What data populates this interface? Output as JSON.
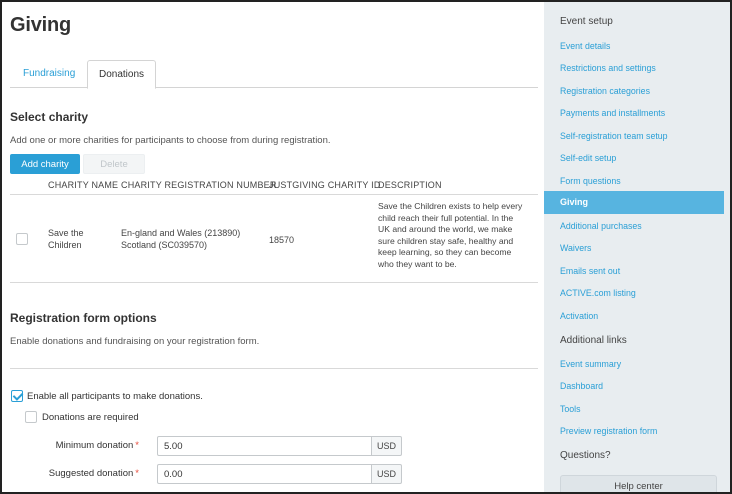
{
  "page": {
    "title": "Giving"
  },
  "tabs": [
    {
      "label": "Fundraising",
      "active": false
    },
    {
      "label": "Donations",
      "active": true
    }
  ],
  "select_charity": {
    "title": "Select charity",
    "helper": "Add one or more charities for participants to choose from during registration.",
    "add_button": "Add charity",
    "delete_button": "Delete",
    "columns": [
      "CHARITY NAME",
      "CHARITY REGISTRATION NUMBER",
      "JUSTGIVING CHARITY ID",
      "DESCRIPTION"
    ],
    "rows": [
      {
        "name_line1": "Save the",
        "name_line2": "Children",
        "reg_line1": "En-gland and Wales (213890)",
        "reg_line2": "Scotland (SC039570)",
        "justgiving_id": "18570",
        "description_lines": [
          "Save the Children exists to help every",
          "child reach their full potential. In the",
          "UK and around the world, we make",
          "sure children stay safe, healthy and",
          "keep learning, so they can become",
          "who they want to be."
        ]
      }
    ]
  },
  "registration_options": {
    "title": "Registration form options",
    "helper": "Enable donations and fundraising on your registration form.",
    "enable_donations_label": "Enable all participants to make donations.",
    "enable_donations_checked": true,
    "donations_required_label": "Donations are required",
    "donations_required_checked": false,
    "minimum_label": "Minimum donation",
    "minimum_value": "5.00",
    "suggested_label": "Suggested donation",
    "suggested_value": "0.00",
    "required_mark": "*",
    "currency": "USD"
  },
  "sidebar": {
    "event_setup_heading": "Event setup",
    "items": [
      "Event details",
      "Restrictions and settings",
      "Registration categories",
      "Payments and installments",
      "Self-registration team setup",
      "Self-edit setup",
      "Form questions",
      "Giving",
      "Additional purchases",
      "Waivers",
      "Emails sent out",
      "ACTIVE.com listing",
      "Activation"
    ],
    "active_item": "Giving",
    "additional_heading": "Additional links",
    "additional_items": [
      "Event summary",
      "Dashboard",
      "Tools",
      "Preview registration form"
    ],
    "questions_heading": "Questions?",
    "help_button": "Help center"
  },
  "colors": {
    "accent": "#2a9fd6",
    "sidebar_bg": "#e8edf0",
    "active_item_bg": "#57b4e0",
    "required": "#e74c3c"
  }
}
